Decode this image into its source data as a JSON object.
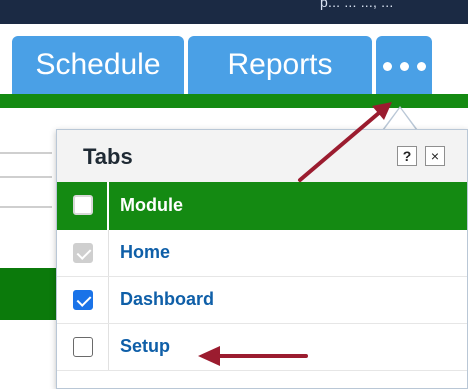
{
  "topbar": {
    "partial_text": "p... ... ..., ..."
  },
  "tabs": [
    {
      "label": "Schedule"
    },
    {
      "label": "Reports"
    },
    {
      "label": "more-options"
    }
  ],
  "popup": {
    "title": "Tabs",
    "help_label": "?",
    "close_label": "×",
    "header_label": "Module",
    "rows": [
      {
        "label": "Home",
        "checked": true,
        "disabled": true
      },
      {
        "label": "Dashboard",
        "checked": true,
        "disabled": false
      },
      {
        "label": "Setup",
        "checked": false,
        "disabled": false
      }
    ]
  },
  "colors": {
    "tab_blue": "#4aa0e6",
    "green": "#148a12",
    "link_blue": "#0f5fa8",
    "arrow_red": "#9b1c2f"
  },
  "icons": [
    "more-dots-icon",
    "help-icon",
    "close-icon",
    "checkbox-icon",
    "arrow-annotation-icon"
  ]
}
